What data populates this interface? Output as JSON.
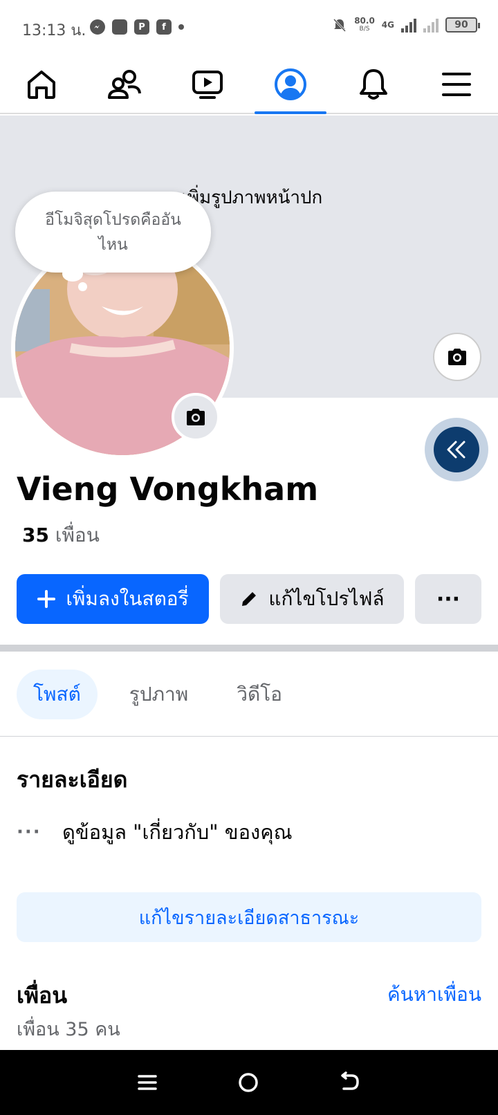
{
  "status_bar": {
    "time": "13:13 น.",
    "apps": [
      "messenger-icon",
      "square-icon",
      "pay-icon",
      "facebook-icon"
    ],
    "net_speed": "80.0",
    "net_speed_unit": "B/S",
    "network": "4G",
    "battery": "90"
  },
  "nav": {
    "tabs": [
      "home-icon",
      "friends-icon",
      "video-icon",
      "profile-icon",
      "bell-icon",
      "menu-icon"
    ],
    "active": "profile-icon",
    "accent": "#1877f2"
  },
  "cover": {
    "add_cover_label": "เพิ่มรูปภาพหน้าปก"
  },
  "thought_bubble": {
    "text": "อีโมจิสุดโปรดคืออันไหน"
  },
  "profile": {
    "name": "Vieng Vongkham",
    "friends_count": "35",
    "friends_label": "เพื่อน"
  },
  "actions": {
    "add_story": "เพิ่มลงในสตอรี่",
    "edit_profile": "แก้ไขโปรไฟล์",
    "more": "···"
  },
  "tabs": {
    "items": [
      "โพสต์",
      "รูปภาพ",
      "วิดีโอ"
    ],
    "active": "โพสต์"
  },
  "details": {
    "title": "รายละเอียด",
    "about_dots": "···",
    "about_text": "ดูข้อมูล \"เกี่ยวกับ\" ของคุณ",
    "edit_public": "แก้ไขรายละเอียดสาธารณะ"
  },
  "friends": {
    "title": "เพื่อน",
    "find": "ค้นหาเพื่อน",
    "count_text": "เพื่อน 35 คน"
  },
  "colors": {
    "primary": "#0866ff",
    "cover_bg": "#e4e6eb",
    "text_secondary": "#65676b"
  }
}
